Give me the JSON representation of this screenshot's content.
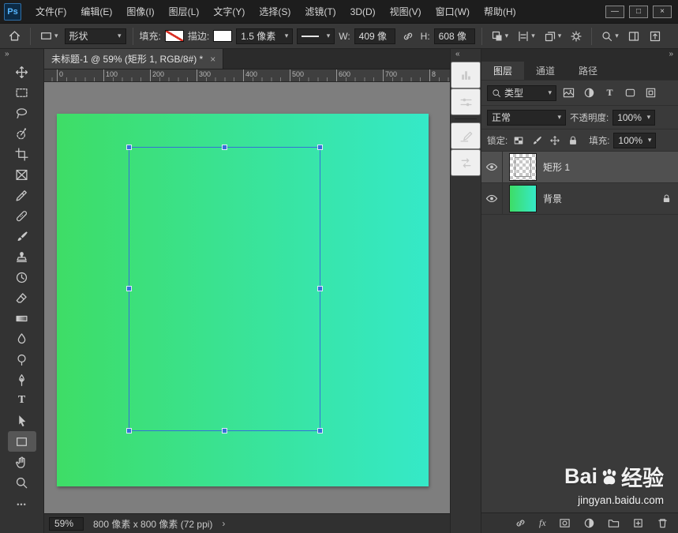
{
  "titlebar": {
    "logo": "Ps",
    "menus": [
      "文件(F)",
      "编辑(E)",
      "图像(I)",
      "图层(L)",
      "文字(Y)",
      "选择(S)",
      "滤镜(T)",
      "3D(D)",
      "视图(V)",
      "窗口(W)",
      "帮助(H)"
    ]
  },
  "options_bar": {
    "shape_mode": "形状",
    "fill_label": "填充:",
    "stroke_label": "描边:",
    "stroke_width": "1.5 像素",
    "w_label": "W:",
    "w_value": "409 像",
    "h_label": "H:",
    "h_value": "608 像"
  },
  "doc": {
    "tab_title": "未标题-1 @ 59% (矩形 1, RGB/8#) *",
    "ruler_ticks": [
      "0",
      "100",
      "200",
      "300",
      "400",
      "500",
      "600",
      "700",
      "8"
    ]
  },
  "panel": {
    "tabs": [
      "图层",
      "通道",
      "路径"
    ],
    "filter_label": "类型",
    "blend_mode": "正常",
    "opacity_label": "不透明度:",
    "opacity_value": "100%",
    "lock_label": "锁定:",
    "fill_label": "填充:",
    "fill_value": "100%",
    "layers": [
      {
        "name": "矩形 1"
      },
      {
        "name": "背景"
      }
    ]
  },
  "status": {
    "zoom": "59%",
    "doc_size": "800 像素 x 800 像素 (72 ppi)"
  },
  "watermark": {
    "brand_prefix": "Bai",
    "brand_suffix": "经验",
    "url": "jingyan.baidu.com"
  },
  "glyphs": {
    "arrow": "▾",
    "chev_left": "«",
    "chev_right": "»",
    "more": "•••",
    "minimize": "—",
    "maximize": "□",
    "close": "×",
    "tab_close": "×",
    "fx": "fx",
    "T": "T",
    "gt": "›"
  },
  "colors": {
    "canvas_gradient_start": "#3edd66",
    "canvas_gradient_end": "#35e9c8",
    "path_blue": "#3570d8"
  }
}
